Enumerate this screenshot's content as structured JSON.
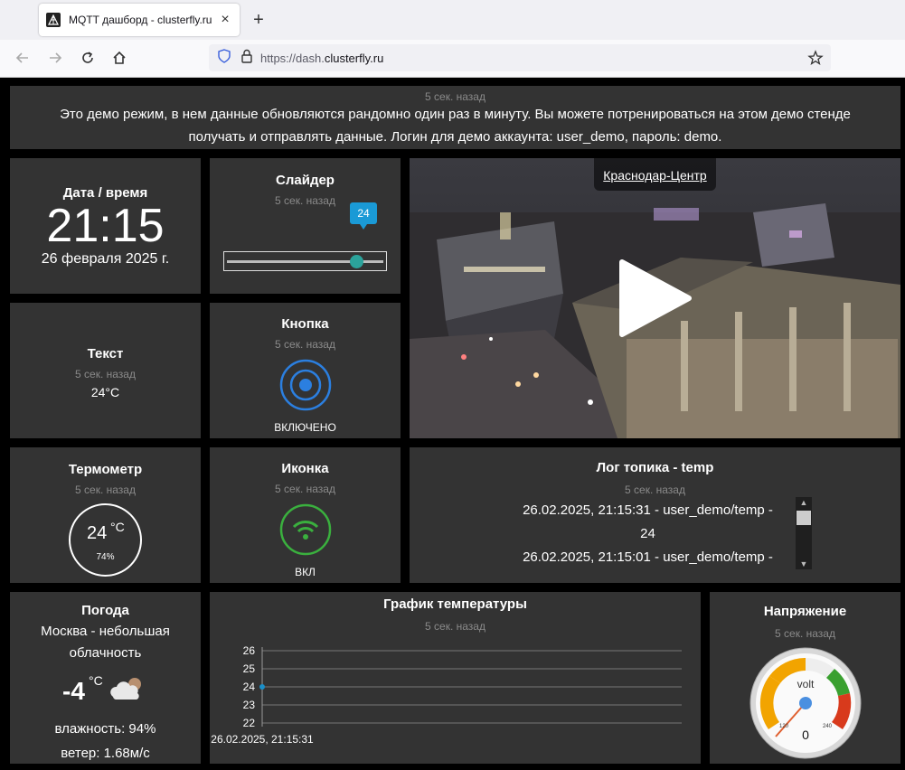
{
  "browser": {
    "tab_title": "MQTT дашборд - clusterfly.ru",
    "url_prefix": "https://dash.",
    "url_domain": "clusterfly.ru",
    "url_suffix": ""
  },
  "banner": {
    "ago": "5 сек. назад",
    "text": "Это демо режим, в нем данные обновляются рандомно один раз в минуту. Вы можете потренироваться на этом демо стенде получать и отправлять данные. Логин для демо аккаунта: user_demo, пароль: demo."
  },
  "datetime": {
    "title": "Дата / время",
    "time": "21:15",
    "date": "26 февраля 2025 г."
  },
  "slider": {
    "title": "Слайдер",
    "ago": "5 сек. назад",
    "value": "24",
    "fraction": 0.86
  },
  "camera": {
    "label": "Краснодар-Центр"
  },
  "text_widget": {
    "title": "Текст",
    "ago": "5 сек. назад",
    "value": "24°C"
  },
  "button": {
    "title": "Кнопка",
    "ago": "5 сек. назад",
    "state": "ВКЛЮЧЕНО",
    "color": "#2b7fe0"
  },
  "thermometer": {
    "title": "Термометр",
    "ago": "5 сек. назад",
    "temp": "24",
    "unit": "°C",
    "humidity": "74%"
  },
  "icon_widget": {
    "title": "Иконка",
    "ago": "5 сек. назад",
    "state": "ВКЛ",
    "color": "#3ab03e"
  },
  "log": {
    "title": "Лог топика - temp",
    "ago": "5 сек. назад",
    "lines": [
      "26.02.2025, 21:15:31 - user_demo/temp -",
      "24",
      "26.02.2025, 21:15:01 - user_demo/temp -"
    ]
  },
  "weather": {
    "title": "Погода",
    "desc": "Москва - небольшая облачность",
    "temp": "-4",
    "unit": "°C",
    "humidity": "влажность: 94%",
    "wind": "ветер: 1.68м/с"
  },
  "chart": {
    "title": "График температуры",
    "ago": "5 сек. назад"
  },
  "chart_data": {
    "type": "line",
    "x": [
      "26.02.2025, 21:15:31"
    ],
    "series": [
      {
        "values": [
          24
        ]
      }
    ],
    "yticks": [
      "26",
      "25",
      "24",
      "23",
      "22"
    ],
    "ylim": [
      22,
      26
    ],
    "grid": true,
    "color": "#1a8fc9"
  },
  "voltage": {
    "title": "Напряжение",
    "ago": "5 сек. назад",
    "unit": "volt",
    "value": "0",
    "min_label": "120",
    "max_label": "240"
  }
}
